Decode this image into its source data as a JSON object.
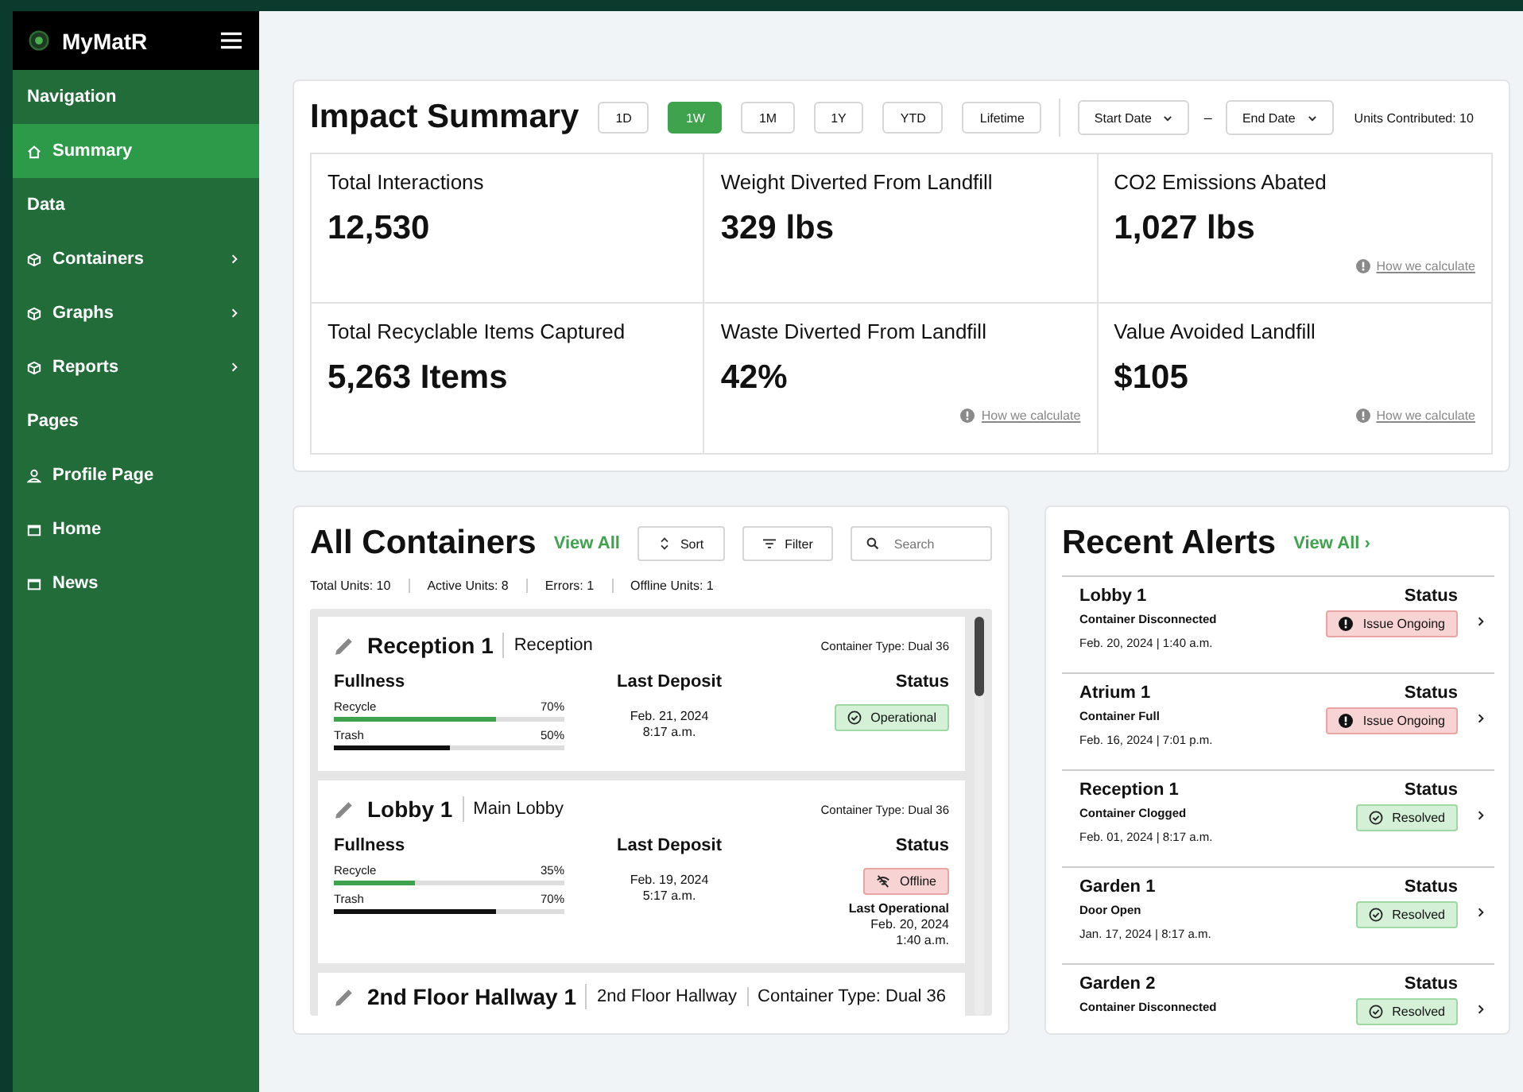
{
  "sidebar": {
    "brand": "MyMatR",
    "items": [
      {
        "kind": "section",
        "label": "Navigation"
      },
      {
        "kind": "link",
        "label": "Summary",
        "selected": true
      },
      {
        "kind": "section",
        "label": "Data"
      },
      {
        "kind": "link",
        "label": "Containers",
        "expandable": true,
        "selected": false
      },
      {
        "kind": "link",
        "label": "Graphs",
        "expandable": true,
        "selected": false
      },
      {
        "kind": "link",
        "label": "Reports",
        "expandable": true,
        "selected": false
      },
      {
        "kind": "section",
        "label": "Pages"
      },
      {
        "kind": "link",
        "label": "Profile Page",
        "selected": false
      },
      {
        "kind": "link",
        "label": "Home",
        "selected": false
      },
      {
        "kind": "link",
        "label": "News",
        "selected": false
      }
    ]
  },
  "impact": {
    "title": "Impact Summary",
    "ranges": [
      {
        "label": "1D",
        "selected": false
      },
      {
        "label": "1W",
        "selected": true
      },
      {
        "label": "1M",
        "selected": false
      },
      {
        "label": "1Y",
        "selected": false
      },
      {
        "label": "YTD",
        "selected": false
      },
      {
        "label": "Lifetime",
        "selected": false
      }
    ],
    "start_date": "Start Date",
    "separator": "–",
    "end_date": "End Date",
    "units": "Units Contributed: 10",
    "stats": [
      {
        "label": "Total Interactions",
        "value": "12,530"
      },
      {
        "label": "Weight Diverted From Landfill",
        "value": "329 lbs"
      },
      {
        "label": "CO2 Emissions Abated",
        "value": "1,027 lbs",
        "link": "How we calculate"
      },
      {
        "label": "Total Recyclable Items Captured",
        "value": "5,263 Items"
      },
      {
        "label": "Waste Diverted From Landfill",
        "value": "42%",
        "link": "How we calculate"
      },
      {
        "label": "Value Avoided Landfill",
        "value": "$105",
        "link": "How we calculate"
      }
    ]
  },
  "containers": {
    "title": "All Containers",
    "view_all": "View All",
    "sort": "Sort",
    "filter": "Filter",
    "search": {
      "placeholder": "Search"
    },
    "counts": [
      "Total Units: 10",
      "Active Units: 8",
      "Errors: 1",
      "Offline Units: 1"
    ],
    "items": [
      {
        "name": "Reception 1",
        "location": "Reception",
        "type": "Container Type: Dual 36",
        "fullness_label": "Fullness",
        "bins": [
          {
            "label": "Recycle",
            "kind": "recycle",
            "reading": "70%",
            "level": 0.7
          },
          {
            "label": "Trash",
            "kind": "trash",
            "reading": "50%",
            "level": 0.5
          }
        ],
        "deposit_label": "Last Deposit",
        "deposit": [
          "Feb. 21, 2024",
          "8:17 a.m."
        ],
        "status_label": "Status",
        "status": {
          "kind": "operational",
          "label": "Operational"
        }
      },
      {
        "name": "Lobby 1",
        "location": "Main Lobby",
        "type": "Container Type: Dual 36",
        "fullness_label": "Fullness",
        "bins": [
          {
            "label": "Recycle",
            "kind": "recycle",
            "reading": "35%",
            "level": 0.35
          },
          {
            "label": "Trash",
            "kind": "trash",
            "reading": "70%",
            "level": 0.7
          }
        ],
        "deposit_label": "Last Deposit",
        "deposit": [
          "Feb. 19, 2024",
          "5:17 a.m."
        ],
        "status_label": "Status",
        "status": {
          "kind": "offline",
          "label": "Offline"
        },
        "last_operational_label": "Last Operational",
        "last_operational": [
          "Feb. 20, 2024",
          "1:40 a.m."
        ]
      },
      {
        "name": "2nd Floor Hallway 1",
        "location": "2nd Floor Hallway",
        "type": "Container Type: Dual 36"
      }
    ]
  },
  "alerts": {
    "title": "Recent Alerts",
    "view_all": "View All ›",
    "items": [
      {
        "name": "Lobby 1",
        "issue": "Container Disconnected",
        "time": "Feb. 20, 2024 | 1:40 a.m.",
        "status_label": "Status",
        "status": {
          "kind": "issue",
          "label": "Issue Ongoing"
        }
      },
      {
        "name": "Atrium 1",
        "issue": "Container Full",
        "time": "Feb. 16, 2024 | 7:01 p.m.",
        "status_label": "Status",
        "status": {
          "kind": "issue",
          "label": "Issue Ongoing"
        }
      },
      {
        "name": "Reception 1",
        "issue": "Container Clogged",
        "time": "Feb. 01, 2024 | 8:17 a.m.",
        "status_label": "Status",
        "status": {
          "kind": "resolved",
          "label": "Resolved"
        }
      },
      {
        "name": "Garden 1",
        "issue": "Door Open",
        "time": "Jan. 17, 2024 | 8:17 a.m.",
        "status_label": "Status",
        "status": {
          "kind": "resolved",
          "label": "Resolved"
        }
      },
      {
        "name": "Garden 2",
        "issue": "Container Disconnected",
        "status_label": "Status",
        "status": {
          "kind": "resolved",
          "label": "Resolved"
        }
      }
    ]
  }
}
